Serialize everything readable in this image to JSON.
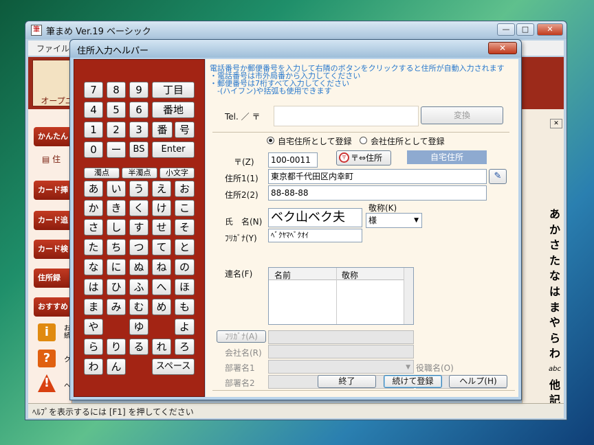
{
  "main_window": {
    "title": "筆まめ Ver.19 ベーシック",
    "buttons": {
      "minimize": "—",
      "maximize": "□",
      "close": "✕"
    },
    "menu": {
      "file": "ファイル"
    },
    "open_label": "オープニ",
    "left_buttons": [
      "かんたん",
      "住",
      "カード挿",
      "カード追",
      "カード検",
      "住所録",
      "おすすめ"
    ],
    "left_icons": [
      {
        "symbol": "i",
        "label": "お\n続"
      },
      {
        "symbol": "?",
        "label": "ク"
      },
      {
        "symbol": "!",
        "label": "ヘ"
      }
    ],
    "vertical_chars": [
      "あ",
      "か",
      "さ",
      "た",
      "な",
      "は",
      "ま",
      "や",
      "ら",
      "わ",
      "abc",
      "他",
      "記"
    ],
    "right_close": "✕",
    "status": "ﾍﾙﾌﾟを表示するには [F1] を押してください"
  },
  "dialog": {
    "title": "住所入力ヘルパー",
    "close": "✕",
    "instructions": [
      "電話番号か郵便番号を入力して右隣のボタンをクリックすると住所が自動入力されます",
      "・電話番号は市外局番から入力してください",
      "・郵便番号は7桁すべて入力してください",
      "　-(ハイフン)や括弧も使用できます"
    ],
    "keypad": {
      "numeric_rows": [
        [
          "7",
          "8",
          "9",
          "丁目"
        ],
        [
          "4",
          "5",
          "6",
          "番地"
        ],
        [
          "1",
          "2",
          "3",
          "番",
          "号"
        ],
        [
          "0",
          "ー",
          "BS",
          "Enter"
        ]
      ],
      "modifier_row": [
        "濁点",
        "半濁点",
        "小文字"
      ],
      "kana_rows": [
        [
          "あ",
          "い",
          "う",
          "え",
          "お"
        ],
        [
          "か",
          "き",
          "く",
          "け",
          "こ"
        ],
        [
          "さ",
          "し",
          "す",
          "せ",
          "そ"
        ],
        [
          "た",
          "ち",
          "つ",
          "て",
          "と"
        ],
        [
          "な",
          "に",
          "ぬ",
          "ね",
          "の"
        ],
        [
          "は",
          "ひ",
          "ふ",
          "へ",
          "ほ"
        ],
        [
          "ま",
          "み",
          "む",
          "め",
          "も"
        ],
        [
          "や",
          "",
          "ゆ",
          "",
          "よ"
        ],
        [
          "ら",
          "り",
          "る",
          "れ",
          "ろ"
        ],
        [
          "わ",
          "ん",
          "",
          "スペース"
        ]
      ]
    },
    "tel_label": "Tel. ／ 〒",
    "tel_value": "",
    "convert_button": "変換",
    "radio_home": "自宅住所として登録",
    "radio_company": "会社住所として登録",
    "zip_label": "〒(Z)",
    "zip_value": "100-0011",
    "swap_button": "〒⇔住所",
    "home_address_tag": "自宅住所",
    "addr1_label": "住所1(1)",
    "addr1_value": "東京都千代田区内幸町",
    "addr2_label": "住所2(2)",
    "addr2_value": "88-88-88",
    "name_label": "氏　名(N)",
    "name_value": "ベク山ベク夫",
    "honorific_label": "敬称(K)",
    "honorific_value": "様",
    "furigana_label": "ﾌﾘｶﾞﾅ(Y)",
    "furigana_value": "ﾍﾞｸﾔﾏﾍﾞｸｵｲ",
    "joint_label": "連名(F)",
    "joint_columns": [
      "名前",
      "敬称"
    ],
    "company_furigana_button": "ﾌﾘｶﾞﾅ(A)",
    "company_label": "会社名(R)",
    "dept1_label": "部署名1",
    "dept2_label": "部署名2",
    "title_label": "役職名(O)",
    "end_button": "終了",
    "continue_button": "続けて登録",
    "help_button": "ヘルプ(H)"
  }
}
